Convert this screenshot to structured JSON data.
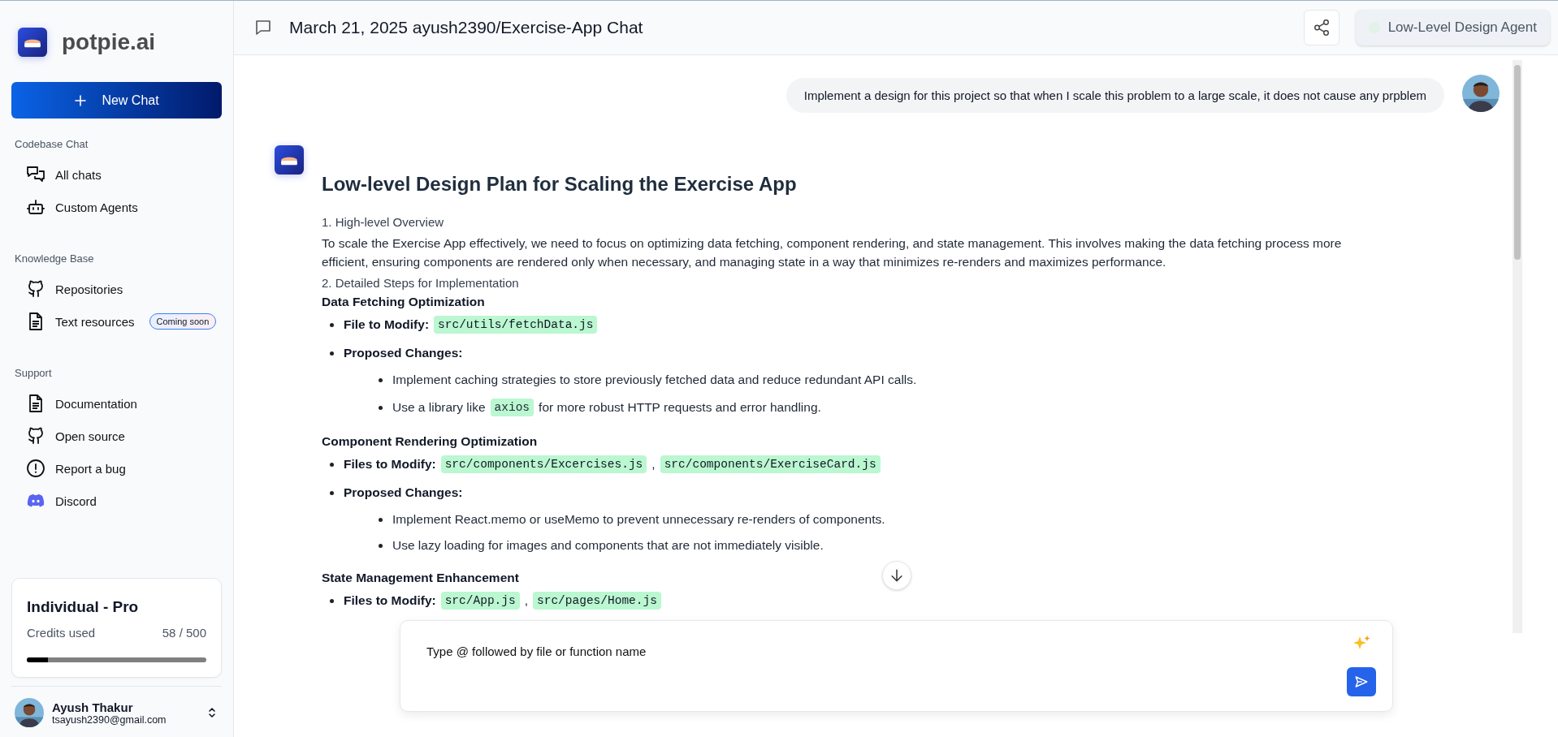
{
  "sidebar": {
    "brand": "potpie.ai",
    "new_chat": "New Chat",
    "sections": [
      {
        "title": "Codebase Chat",
        "items": [
          {
            "kind": "chats",
            "label": "All chats"
          },
          {
            "kind": "robot",
            "label": "Custom Agents"
          }
        ]
      },
      {
        "title": "Knowledge Base",
        "items": [
          {
            "kind": "github",
            "label": "Repositories"
          },
          {
            "kind": "document",
            "label": "Text resources",
            "badge": "Coming soon"
          }
        ]
      },
      {
        "title": "Support",
        "items": [
          {
            "kind": "document",
            "label": "Documentation"
          },
          {
            "kind": "github",
            "label": "Open source"
          },
          {
            "kind": "alert",
            "label": "Report a bug"
          },
          {
            "kind": "discord",
            "label": "Discord"
          }
        ]
      }
    ],
    "plan": {
      "name": "Individual - Pro",
      "credits_label": "Credits used",
      "credits": "58 / 500",
      "level": 0.116
    },
    "user": {
      "name": "Ayush Thakur",
      "email": "tsayush2390@gmail.com"
    }
  },
  "header": {
    "title": "March 21, 2025 ayush2390/Exercise-App Chat",
    "agent": "Low-Level Design Agent"
  },
  "messages": [
    {
      "kind": "user",
      "text": "Implement a design for this project so that when I scale this problem to a large scale, it does not cause any prpblem"
    },
    {
      "kind": "assistant",
      "blocks": [
        {
          "kind": "title",
          "text": "Low-level Design Plan for Scaling the Exercise App"
        },
        {
          "kind": "step",
          "text": "1. High-level Overview"
        },
        {
          "kind": "paragraph",
          "text": "To scale the Exercise App effectively, we need to focus on optimizing data fetching, component rendering, and state management. This involves making the data fetching process more efficient, ensuring components are rendered only when necessary, and managing state in a way that minimizes re-renders and maximizes performance."
        },
        {
          "kind": "step",
          "text": "2. Detailed Steps for Implementation"
        },
        {
          "kind": "heading",
          "text": "Data Fetching Optimization"
        },
        {
          "kind": "bullet",
          "label": "File to Modify:",
          "parts": [
            {
              "kind": "code",
              "text": "src/utils/fetchData.js"
            }
          ]
        },
        {
          "kind": "bullet",
          "label": "Proposed Changes:",
          "children": [
            {
              "parts": [
                {
                  "kind": "text",
                  "text": "Implement caching strategies to store previously fetched data and reduce redundant API calls."
                }
              ]
            },
            {
              "parts": [
                {
                  "kind": "text",
                  "text": "Use a library like"
                },
                {
                  "kind": "code",
                  "text": "axios"
                },
                {
                  "kind": "text",
                  "text": "for more robust HTTP requests and error handling."
                }
              ]
            }
          ]
        },
        {
          "kind": "heading",
          "text": "Component Rendering Optimization"
        },
        {
          "kind": "bullet",
          "label": "Files to Modify:",
          "parts": [
            {
              "kind": "code",
              "text": "src/components/Excercises.js"
            },
            {
              "kind": "text",
              "text": ","
            },
            {
              "kind": "code",
              "text": "src/components/ExerciseCard.js"
            }
          ]
        },
        {
          "kind": "bullet",
          "label": "Proposed Changes:",
          "children": [
            {
              "parts": [
                {
                  "kind": "text",
                  "text": "Implement React.memo or useMemo to prevent unnecessary re-renders of components."
                }
              ]
            },
            {
              "parts": [
                {
                  "kind": "text",
                  "text": "Use lazy loading for images and components that are not immediately visible."
                }
              ]
            }
          ]
        },
        {
          "kind": "heading",
          "text": "State Management Enhancement"
        },
        {
          "kind": "bullet",
          "label": "Files to Modify:",
          "parts": [
            {
              "kind": "code",
              "text": "src/App.js"
            },
            {
              "kind": "text",
              "text": ","
            },
            {
              "kind": "code",
              "text": "src/pages/Home.js"
            }
          ]
        }
      ]
    }
  ],
  "composer": {
    "placeholder": "Type @ followed by file or function name"
  }
}
